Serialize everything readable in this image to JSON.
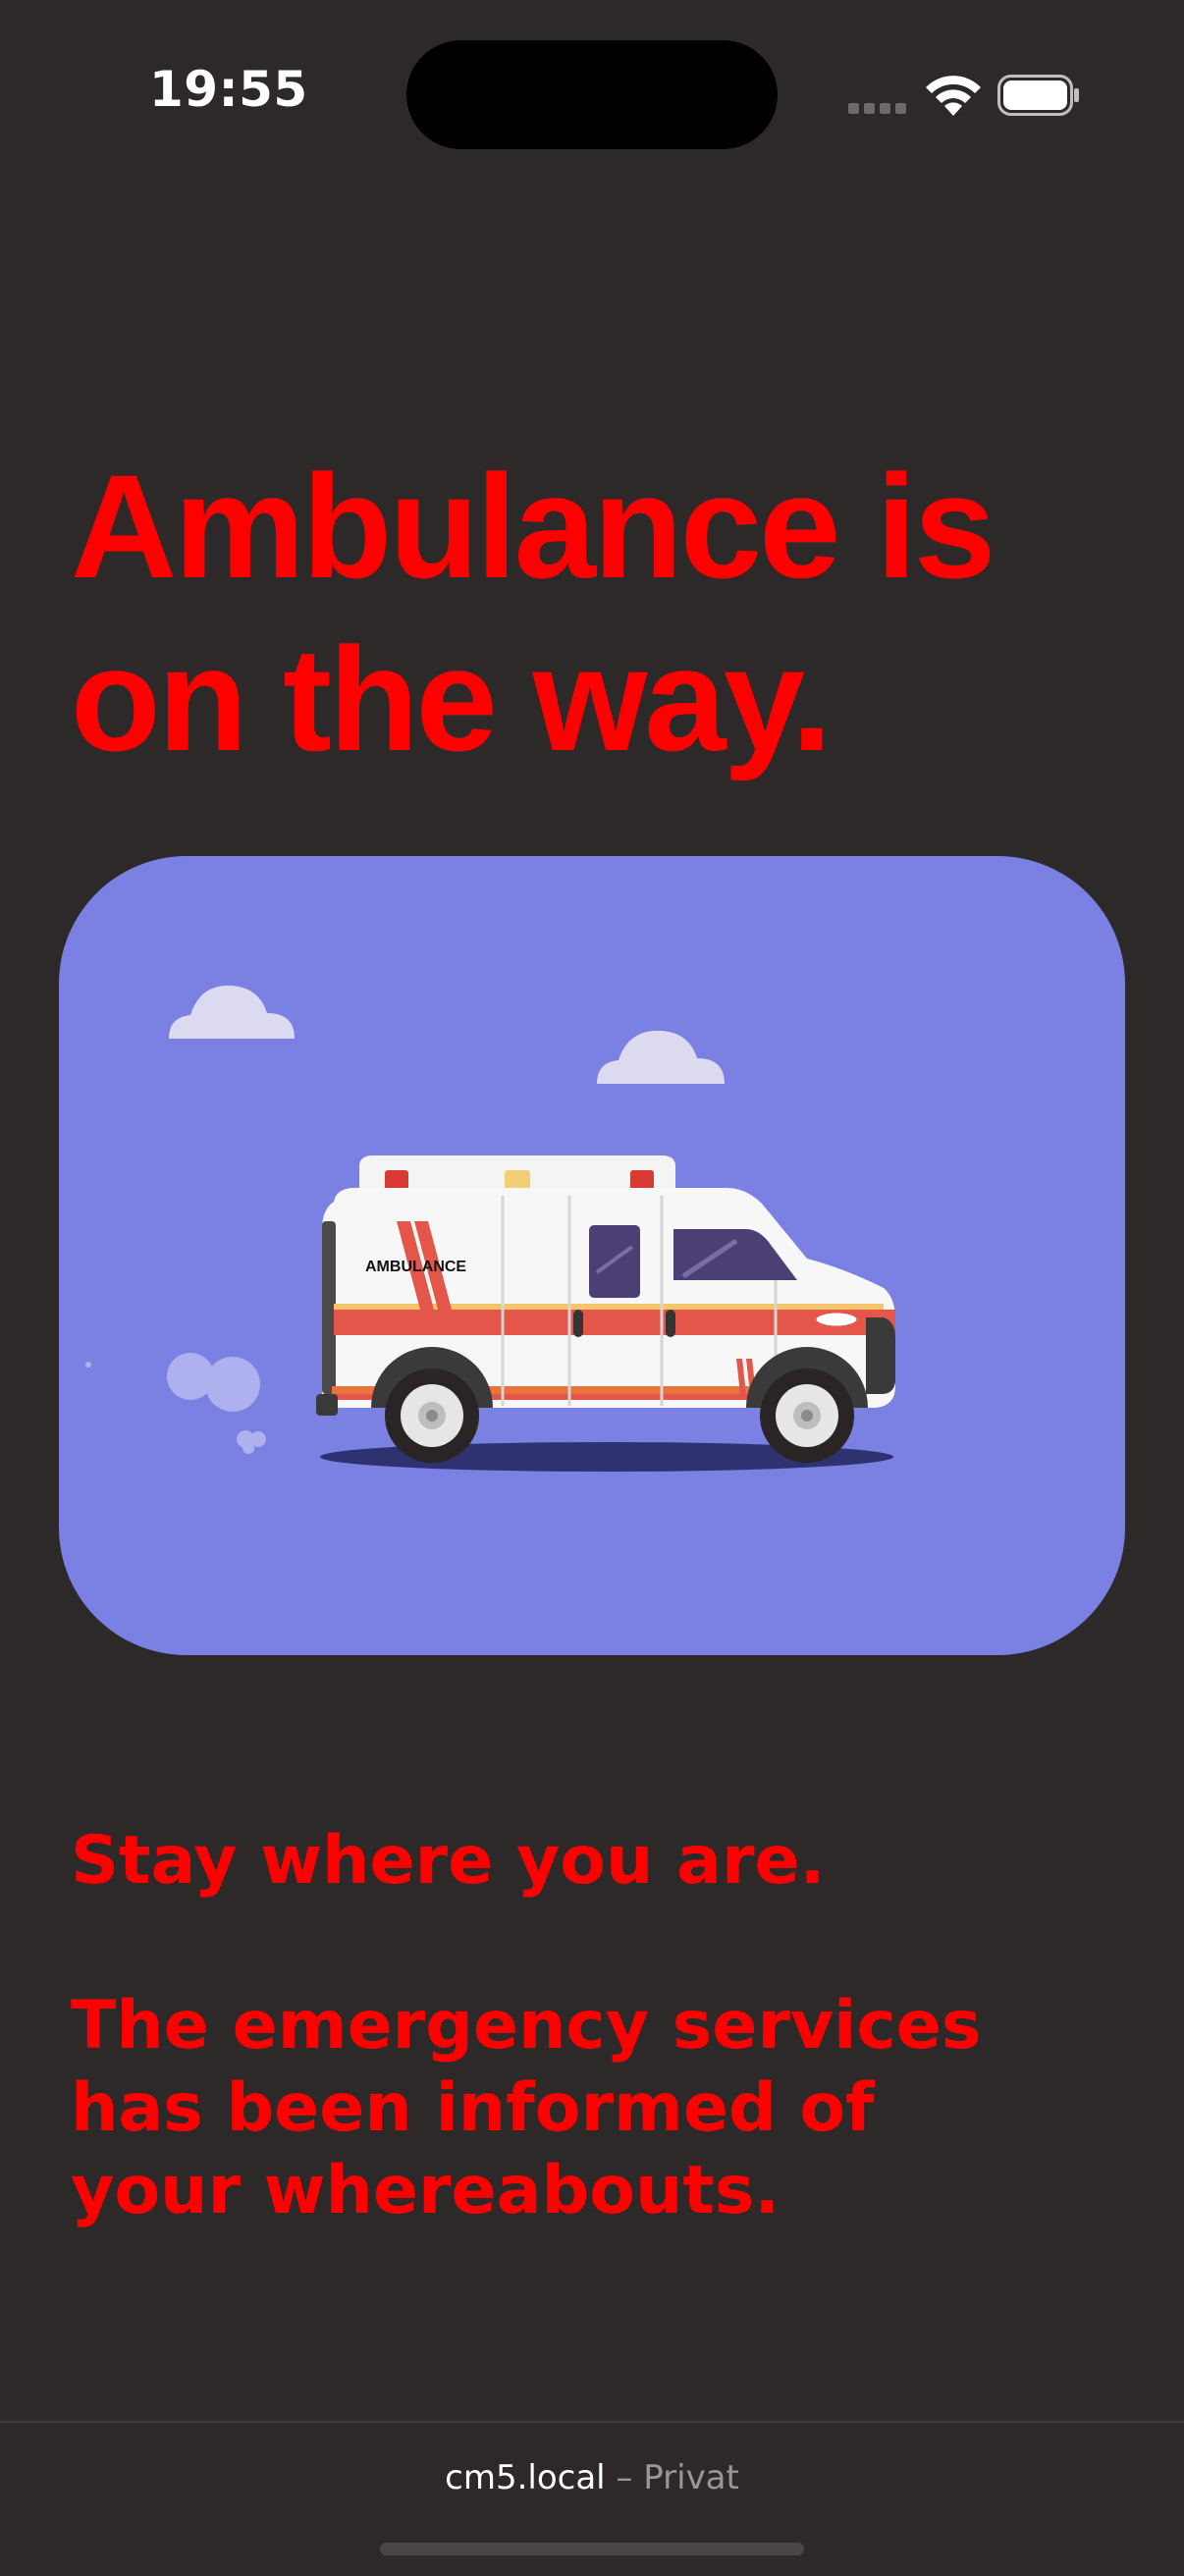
{
  "status_bar": {
    "time": "19:55",
    "icons": [
      "cellular-signal-icon",
      "wifi-icon",
      "battery-icon"
    ]
  },
  "main": {
    "headline_line1": "Ambulance is",
    "headline_line2": "on the way.",
    "illustration": {
      "vehicle_label": "AMBULANCE",
      "background_color": "#7b80e3"
    },
    "message_1": "Stay where you are.",
    "message_2_line1": "The emergency services",
    "message_2_line2": "has been informed of",
    "message_2_line3": "your whereabouts.",
    "accent_color": "#ff0000"
  },
  "browser_bar": {
    "host": "cm5.local",
    "separator": "–",
    "mode": "Privat"
  }
}
